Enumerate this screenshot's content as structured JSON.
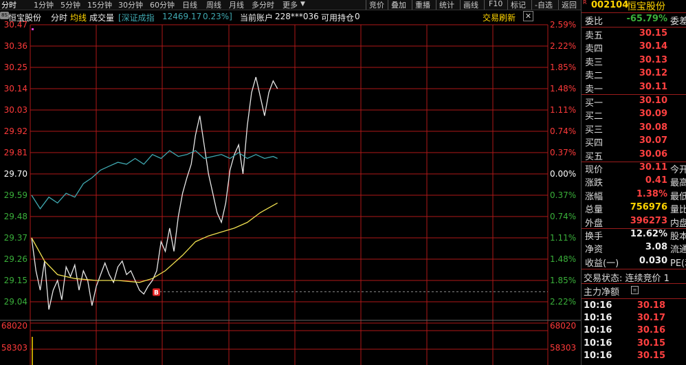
{
  "toolbar": {
    "periods": [
      "分时",
      "1分钟",
      "5分钟",
      "15分钟",
      "30分钟",
      "60分钟",
      "日线",
      "周线",
      "月线",
      "多分时",
      "更多"
    ],
    "tools": [
      "竞价",
      "叠加",
      "重播",
      "统计",
      "画线",
      "F10",
      "标记",
      "-自选",
      "返回"
    ]
  },
  "info": {
    "stock_name": "恒宝股份",
    "mode": "分时",
    "avg_line": "均线",
    "volume": "成交量",
    "index_name": "[深证成指",
    "index_value": "12469.17",
    "index_change": "0.23%]",
    "account_label": "当前账户",
    "account_value": "228***036",
    "position_label": "可用持仓",
    "position_value": "0",
    "refresh_label": "交易刷新",
    "badge": "8S"
  },
  "chart_data": {
    "type": "line",
    "title": "",
    "xlabel": "",
    "ylabel": "",
    "ylim": [
      28.93,
      30.47
    ],
    "prev_close": 29.7,
    "price_ticks": [
      "30.47",
      "30.36",
      "30.25",
      "30.14",
      "30.03",
      "29.92",
      "29.81",
      "29.70",
      "29.59",
      "29.48",
      "29.37",
      "29.26",
      "29.15",
      "29.04"
    ],
    "pct_ticks": [
      "2.59%",
      "2.22%",
      "1.85%",
      "1.48%",
      "1.11%",
      "0.74%",
      "0.37%",
      "0.00%",
      "0.37%",
      "0.74%",
      "1.11%",
      "1.48%",
      "1.85%",
      "2.22%"
    ],
    "volume_ticks": [
      "68020",
      "58303"
    ],
    "series": [
      {
        "name": "分时",
        "color": "#e8e8e8",
        "values": [
          [
            0,
            29.37
          ],
          [
            2,
            29.2
          ],
          [
            4,
            29.1
          ],
          [
            6,
            29.25
          ],
          [
            8,
            29.0
          ],
          [
            10,
            29.1
          ],
          [
            12,
            29.15
          ],
          [
            14,
            29.05
          ],
          [
            16,
            29.22
          ],
          [
            18,
            29.17
          ],
          [
            20,
            29.23
          ],
          [
            22,
            29.1
          ],
          [
            24,
            29.2
          ],
          [
            26,
            29.15
          ],
          [
            28,
            29.02
          ],
          [
            30,
            29.12
          ],
          [
            32,
            29.18
          ],
          [
            34,
            29.24
          ],
          [
            36,
            29.18
          ],
          [
            38,
            29.14
          ],
          [
            40,
            29.22
          ],
          [
            42,
            29.25
          ],
          [
            44,
            29.18
          ],
          [
            46,
            29.2
          ],
          [
            48,
            29.15
          ],
          [
            50,
            29.1
          ],
          [
            52,
            29.08
          ],
          [
            54,
            29.12
          ],
          [
            56,
            29.15
          ],
          [
            58,
            29.2
          ],
          [
            60,
            29.35
          ],
          [
            62,
            29.3
          ],
          [
            64,
            29.42
          ],
          [
            66,
            29.3
          ],
          [
            68,
            29.48
          ],
          [
            70,
            29.6
          ],
          [
            72,
            29.68
          ],
          [
            74,
            29.75
          ],
          [
            76,
            29.9
          ],
          [
            78,
            30.0
          ],
          [
            80,
            29.85
          ],
          [
            82,
            29.7
          ],
          [
            84,
            29.6
          ],
          [
            86,
            29.5
          ],
          [
            88,
            29.45
          ],
          [
            90,
            29.55
          ],
          [
            92,
            29.72
          ],
          [
            94,
            29.8
          ],
          [
            96,
            29.85
          ],
          [
            98,
            29.7
          ],
          [
            100,
            29.95
          ],
          [
            102,
            30.12
          ],
          [
            104,
            30.2
          ],
          [
            106,
            30.1
          ],
          [
            108,
            30.0
          ],
          [
            110,
            30.12
          ],
          [
            112,
            30.18
          ],
          [
            114,
            30.14
          ]
        ]
      },
      {
        "name": "均线",
        "color": "#f0e050",
        "values": [
          [
            0,
            29.37
          ],
          [
            6,
            29.25
          ],
          [
            12,
            29.18
          ],
          [
            20,
            29.16
          ],
          [
            30,
            29.15
          ],
          [
            40,
            29.15
          ],
          [
            50,
            29.14
          ],
          [
            56,
            29.16
          ],
          [
            62,
            29.2
          ],
          [
            70,
            29.28
          ],
          [
            76,
            29.35
          ],
          [
            82,
            29.38
          ],
          [
            88,
            29.4
          ],
          [
            94,
            29.42
          ],
          [
            100,
            29.45
          ],
          [
            106,
            29.5
          ],
          [
            114,
            29.55
          ]
        ]
      },
      {
        "name": "深证成指",
        "color": "#3fa8b0",
        "values": [
          [
            0,
            29.59
          ],
          [
            4,
            29.52
          ],
          [
            8,
            29.58
          ],
          [
            12,
            29.55
          ],
          [
            16,
            29.6
          ],
          [
            20,
            29.58
          ],
          [
            24,
            29.65
          ],
          [
            28,
            29.68
          ],
          [
            32,
            29.72
          ],
          [
            36,
            29.74
          ],
          [
            40,
            29.76
          ],
          [
            44,
            29.75
          ],
          [
            48,
            29.78
          ],
          [
            52,
            29.75
          ],
          [
            56,
            29.8
          ],
          [
            60,
            29.78
          ],
          [
            64,
            29.82
          ],
          [
            68,
            29.79
          ],
          [
            72,
            29.8
          ],
          [
            76,
            29.82
          ],
          [
            80,
            29.78
          ],
          [
            84,
            29.79
          ],
          [
            88,
            29.8
          ],
          [
            92,
            29.78
          ],
          [
            96,
            29.81
          ],
          [
            100,
            29.78
          ],
          [
            104,
            29.8
          ],
          [
            108,
            29.78
          ],
          [
            112,
            29.79
          ],
          [
            114,
            29.78
          ]
        ]
      }
    ],
    "marker": {
      "label": "B",
      "x": 58,
      "y": 29.12
    },
    "colors": {
      "grid": "#b01818",
      "price_up": "#ff3a3a",
      "price_down": "#3ab03a",
      "flat": "#ffffff"
    }
  },
  "panel": {
    "code": "002104",
    "name": "恒宝股份",
    "r_marker": "R",
    "webi_label": "委比",
    "webi_value": "-65.79%",
    "weicha_label": "委差",
    "asks": [
      {
        "label": "卖五",
        "price": "30.15"
      },
      {
        "label": "卖四",
        "price": "30.14"
      },
      {
        "label": "卖三",
        "price": "30.13"
      },
      {
        "label": "卖二",
        "price": "30.12"
      },
      {
        "label": "卖一",
        "price": "30.11"
      }
    ],
    "bids": [
      {
        "label": "买一",
        "price": "30.10"
      },
      {
        "label": "买二",
        "price": "30.09"
      },
      {
        "label": "买三",
        "price": "30.08"
      },
      {
        "label": "买四",
        "price": "30.07"
      },
      {
        "label": "买五",
        "price": "30.06"
      }
    ],
    "quotes": [
      {
        "label": "现价",
        "value": "30.11",
        "right": "今开"
      },
      {
        "label": "涨跌",
        "value": "0.41",
        "right": "最高"
      },
      {
        "label": "涨幅",
        "value": "1.38%",
        "right": "最低"
      },
      {
        "label": "总量",
        "value": "756976",
        "right": "量比"
      },
      {
        "label": "外盘",
        "value": "396273",
        "right": "内盘"
      }
    ],
    "stats": [
      {
        "label": "换手",
        "value": "12.62%",
        "right": "股本"
      },
      {
        "label": "净资",
        "value": "3.08",
        "right": "流通"
      },
      {
        "label": "收益(一)",
        "value": "0.030",
        "right": "PE(动"
      }
    ],
    "trade_status": "交易状态: 连续竞价 1",
    "main_flow": "主力净额",
    "ticks": [
      {
        "time": "10:16",
        "price": "30.18"
      },
      {
        "time": "10:16",
        "price": "30.17"
      },
      {
        "time": "10:16",
        "price": "30.16"
      },
      {
        "time": "10:16",
        "price": "30.15"
      },
      {
        "time": "10:16",
        "price": "30.15"
      }
    ]
  }
}
